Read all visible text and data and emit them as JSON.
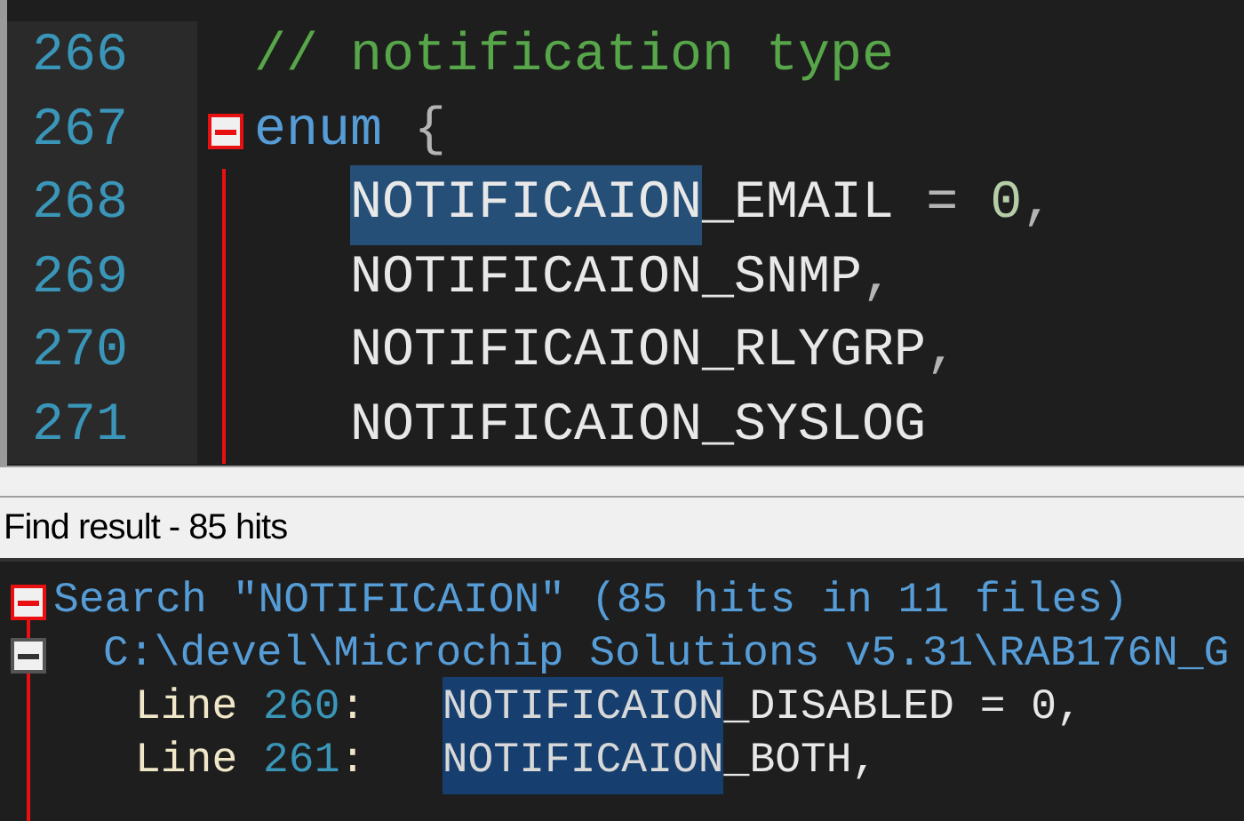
{
  "editor": {
    "lines": [
      {
        "number": "266",
        "tokens": [
          {
            "kind": "comment",
            "text": "// notification type"
          }
        ]
      },
      {
        "number": "267",
        "expanded": true,
        "tokens": [
          {
            "kind": "keyword",
            "text": "enum"
          },
          {
            "kind": "punct",
            "text": " {"
          }
        ],
        "children": [
          {
            "number": "268",
            "tokens": [
              {
                "kind": "ident",
                "text": "NOTIFICAION",
                "highlighted": true
              },
              {
                "kind": "ident",
                "text": "_EMAIL"
              },
              {
                "kind": "punct",
                "text": " = "
              },
              {
                "kind": "number",
                "text": "0"
              },
              {
                "kind": "punct",
                "text": ","
              }
            ]
          },
          {
            "number": "269",
            "tokens": [
              {
                "kind": "ident",
                "text": "NOTIFICAION_SNMP"
              },
              {
                "kind": "punct",
                "text": ","
              }
            ]
          },
          {
            "number": "270",
            "tokens": [
              {
                "kind": "ident",
                "text": "NOTIFICAION_RLYGRP"
              },
              {
                "kind": "punct",
                "text": ","
              }
            ]
          },
          {
            "number": "271",
            "tokens": [
              {
                "kind": "ident",
                "text": "NOTIFICAION_SYSLOG"
              }
            ]
          }
        ]
      }
    ]
  },
  "find_panel": {
    "title": "Find result - 85 hits",
    "searches": [
      {
        "text": "Search \"NOTIFICAION\" (85 hits in 11 files)",
        "expanded": true,
        "files": [
          {
            "path": "C:\\devel\\Microchip Solutions v5.31\\RAB176N_G",
            "expanded": true,
            "hits": [
              {
                "label": "Line",
                "number": "260",
                "suffix": ":",
                "match": "NOTIFICAION",
                "rest": "_DISABLED = 0,"
              },
              {
                "label": "Line",
                "number": "261",
                "suffix": ":",
                "match": "NOTIFICAION",
                "rest": "_BOTH,"
              }
            ]
          }
        ]
      }
    ]
  }
}
